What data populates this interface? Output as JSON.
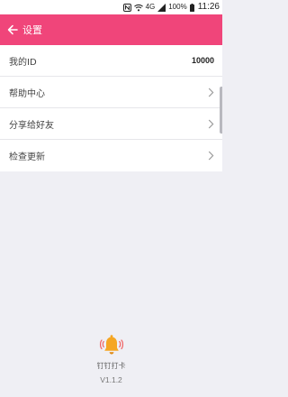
{
  "status_bar": {
    "battery": "100%",
    "time": "11:26",
    "network": "4G"
  },
  "header": {
    "title": "设置"
  },
  "settings": [
    {
      "label": "我的ID",
      "value": "10000"
    },
    {
      "label": "帮助中心"
    },
    {
      "label": "分享给好友"
    },
    {
      "label": "检查更新"
    }
  ],
  "footer": {
    "app_name": "钉钉打卡",
    "version": "V1.1.2"
  },
  "colors": {
    "accent": "#f0457a",
    "background": "#efeff4",
    "bell": "#f5a623"
  },
  "icons": {
    "back": "arrow-left-icon",
    "chevron": "chevron-right-icon",
    "bell": "bell-icon"
  }
}
